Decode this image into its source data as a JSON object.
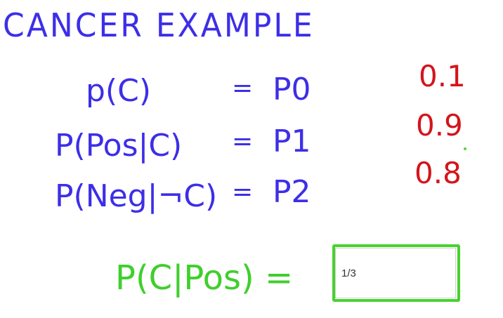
{
  "title": "CANCER EXAMPLE",
  "equations": [
    {
      "lhs": "p(C)",
      "equals": "=",
      "rhs": "P0"
    },
    {
      "lhs": "P(Pos|C)",
      "equals": "=",
      "rhs": "P1"
    },
    {
      "lhs": "P(Neg|¬C)",
      "equals": "=",
      "rhs": "P2"
    }
  ],
  "values": [
    "0.1",
    "0.9",
    "0.8"
  ],
  "question": {
    "label": "P(C|Pos) =",
    "answer_value": "1/3"
  },
  "colors": {
    "blue": "#3d2ee8",
    "red": "#d4141c",
    "green": "#3fcf2c"
  }
}
